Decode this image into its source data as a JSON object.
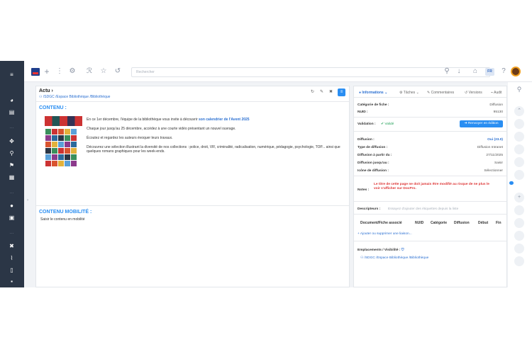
{
  "search": {
    "placeholder": "Rechercher"
  },
  "header": {
    "lang": "FR"
  },
  "page": {
    "title": "Actu",
    "breadcrumb": "/SDGC /Espace Bibliothèque /Bibliothèque",
    "contenu_title": "CONTENU :",
    "p1_pre": "En ce 1er décembre, l'équipe de la bibliothèque vous invite à découvrir ",
    "p1_link": "son calendrier de l'Avent 2025",
    "p2": "Chaque jour jusqu'au 25 décembre, accédez à une courte vidéo présentant un nouvel ouvrage.",
    "p3": "Écoutez et regardez les auteurs évoquer leurs travaux.",
    "p4": "Découvrez une sélection illustrant la diversité de nos collections : police, droit, VIF, criminalité, radicalisation, numérique, pédagogie, psychologie, TOP... ainsi que quelques romans graphiques pour les week-ends.",
    "mobilite_title": "CONTENU MOBILITÉ :",
    "mobilite_text": "Saisir le contenu en mobilité"
  },
  "tabs": [
    "Informations",
    "Tâches",
    "Commentaires",
    "Versions",
    "Audit"
  ],
  "info": {
    "categorie_label": "Catégorie de fiche :",
    "categorie_value": "Diffusion",
    "nuid_label": "NUID :",
    "nuid_value": "95130",
    "validation_label": "Validation :",
    "validation_value": "✔ Validé",
    "renvoyer_label": "Renvoyer en édition",
    "diffusion_label": "Diffusion :",
    "diffusion_value": "Oui (23.0)",
    "type_label": "Type de diffusion :",
    "type_value": "Diffusion Intranet",
    "partir_label": "Diffusion à partir du :",
    "partir_value": "27/11/2025",
    "jusqu_label": "Diffusion jusqu'au :",
    "jusqu_value": "Saisir",
    "icone_label": "Icône de diffusion :",
    "icone_value": "Sélectionner",
    "notes_label": "Notes :",
    "notes_value": "Le titre de cette page ne doit jamais être modifié au risque de ne plus le voir s'afficher sur DocPro.",
    "descripteurs_label": "Descripteurs :",
    "descripteurs_placeholder": "Essayez d'ajouter des étiquettes depuis la liste",
    "table_headers": [
      "Document/Fiche associé",
      "NUID",
      "Catégorie",
      "Diffusion",
      "Début",
      "Fin"
    ],
    "add_link": "Ajouter ou supprimer une liaison...",
    "emplacements_label": "Emplacements / Visibilité :",
    "emplacement_path": "/SDGC /Espace Bibliothèque /Bibliothèque"
  }
}
